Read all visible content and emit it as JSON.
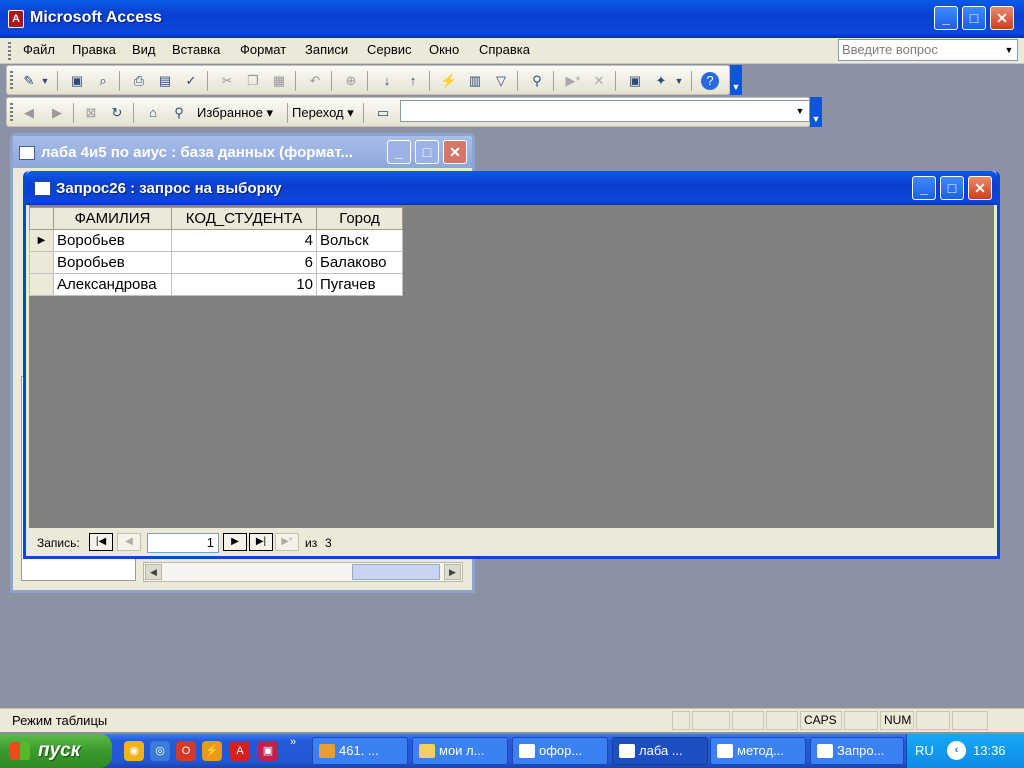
{
  "app": {
    "title": "Microsoft Access",
    "icon_label": "A"
  },
  "menu": {
    "items": [
      "Файл",
      "Правка",
      "Вид",
      "Вставка",
      "Формат",
      "Записи",
      "Сервис",
      "Окно",
      "Справка"
    ],
    "ask_placeholder": "Введите вопрос"
  },
  "web_toolbar": {
    "favorites_label": "Избранное",
    "goto_label": "Переход"
  },
  "db_window": {
    "title": "лаба 4и5 по аиус : база данных (формат..."
  },
  "query_window": {
    "title": "Запрос26 : запрос на выборку",
    "columns": [
      "ФАМИЛИЯ",
      "КОД_СТУДЕНТА",
      "Город"
    ],
    "rows": [
      {
        "surname": "Воробьев",
        "code": "4",
        "city": "Вольск"
      },
      {
        "surname": "Воробьев",
        "code": "6",
        "city": "Балаково"
      },
      {
        "surname": "Александрова",
        "code": "10",
        "city": "Пугачев"
      }
    ],
    "nav": {
      "record_label": "Запись:",
      "current": "1",
      "of_label": "из",
      "total": "3"
    }
  },
  "status": {
    "text": "Режим таблицы",
    "caps": "CAPS",
    "num": "NUM"
  },
  "taskbar": {
    "start_label": "пуск",
    "tasks": [
      "461. ...",
      "мои л...",
      "офор...",
      "лаба ...",
      "метод...",
      "Запро..."
    ],
    "lang": "RU",
    "clock": "13:36"
  },
  "colors": {
    "titlebar": "#0a46d8",
    "chrome": "#ece9d8",
    "workspace": "#8b92a4",
    "taskbar": "#235ad8",
    "start": "#3a9b2c"
  }
}
